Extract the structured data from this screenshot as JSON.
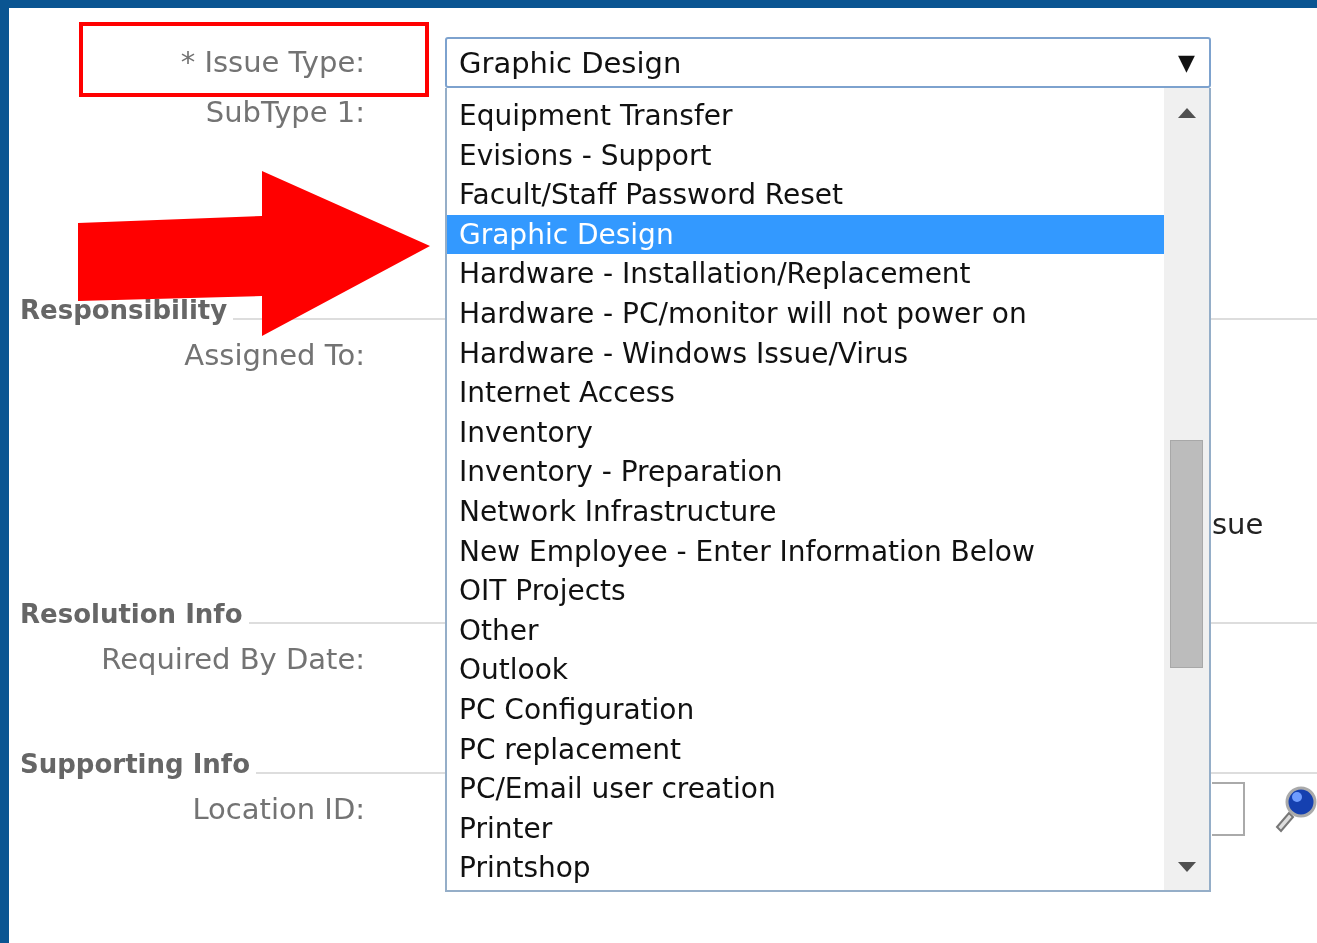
{
  "form": {
    "rows": [
      {
        "kind": "field",
        "label": "* Issue Type:"
      },
      {
        "kind": "field",
        "label": "SubType 1:"
      },
      {
        "kind": "section",
        "label": "Responsibility"
      },
      {
        "kind": "field",
        "label": "Assigned To:"
      },
      {
        "kind": "fragment",
        "label": "sue"
      },
      {
        "kind": "section",
        "label": "Resolution Info"
      },
      {
        "kind": "field",
        "label": "Required By Date:"
      },
      {
        "kind": "section",
        "label": "Supporting Info"
      },
      {
        "kind": "lookup",
        "label": "Location ID:"
      }
    ]
  },
  "issue_type_dropdown": {
    "value": "Graphic Design",
    "caret": "▼",
    "options": [
      {
        "label": "Equipment Transfer",
        "selected": false
      },
      {
        "label": "Evisions - Support",
        "selected": false
      },
      {
        "label": "Facult/Staff Password Reset",
        "selected": false
      },
      {
        "label": "Graphic Design",
        "selected": true
      },
      {
        "label": "Hardware - Installation/Replacement",
        "selected": false
      },
      {
        "label": "Hardware - PC/monitor will not power on",
        "selected": false
      },
      {
        "label": "Hardware - Windows Issue/Virus",
        "selected": false
      },
      {
        "label": "Internet Access",
        "selected": false
      },
      {
        "label": "Inventory",
        "selected": false
      },
      {
        "label": "Inventory - Preparation",
        "selected": false
      },
      {
        "label": "Network Infrastructure",
        "selected": false
      },
      {
        "label": "New Employee - Enter Information Below",
        "selected": false
      },
      {
        "label": "OIT Projects",
        "selected": false
      },
      {
        "label": "Other",
        "selected": false
      },
      {
        "label": "Outlook",
        "selected": false
      },
      {
        "label": "PC Configuration",
        "selected": false
      },
      {
        "label": "PC replacement",
        "selected": false
      },
      {
        "label": "PC/Email user creation",
        "selected": false
      },
      {
        "label": "Printer",
        "selected": false
      },
      {
        "label": "Printshop",
        "selected": false
      }
    ]
  }
}
